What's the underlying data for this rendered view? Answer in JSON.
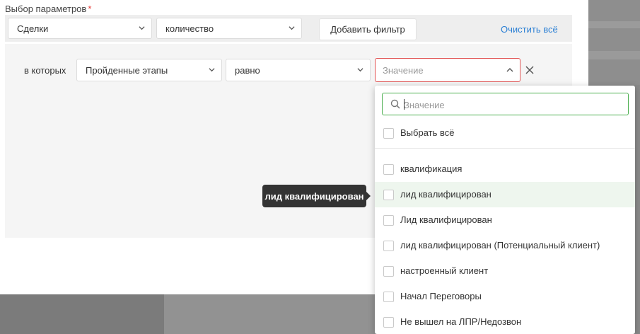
{
  "section": {
    "title": "Выбор параметров",
    "required_mark": "*"
  },
  "filter_bar": {
    "entity_select": "Сделки",
    "metric_select": "количество",
    "add_filter_label": "Добавить фильтр",
    "clear_all_label": "Очистить всё"
  },
  "condition": {
    "label": "в которых",
    "field_select": "Пройденные этапы",
    "operator_select": "равно",
    "value_placeholder": "Значение"
  },
  "dropdown": {
    "search_placeholder": "Значение",
    "select_all_label": "Выбрать всё",
    "options": [
      {
        "label": "квалификация",
        "checked": false
      },
      {
        "label": "лид квалифицирован",
        "checked": false,
        "hovered": true
      },
      {
        "label": "Лид квалифицирован",
        "checked": false
      },
      {
        "label": "лид квалифицирован (Потенциальный клиент)",
        "checked": false
      },
      {
        "label": "настроенный клиент",
        "checked": false
      },
      {
        "label": "Начал Переговоры",
        "checked": false
      },
      {
        "label": "Не вышел на ЛПР/Недозвон",
        "checked": false
      }
    ]
  },
  "tooltip": {
    "text": "лид квалифицирован"
  },
  "colors": {
    "accent_link": "#2a7fd4",
    "error_border": "#e25555",
    "search_focus": "#4caf50",
    "hover_row": "#eef6ee",
    "tooltip_bg": "#333333"
  }
}
